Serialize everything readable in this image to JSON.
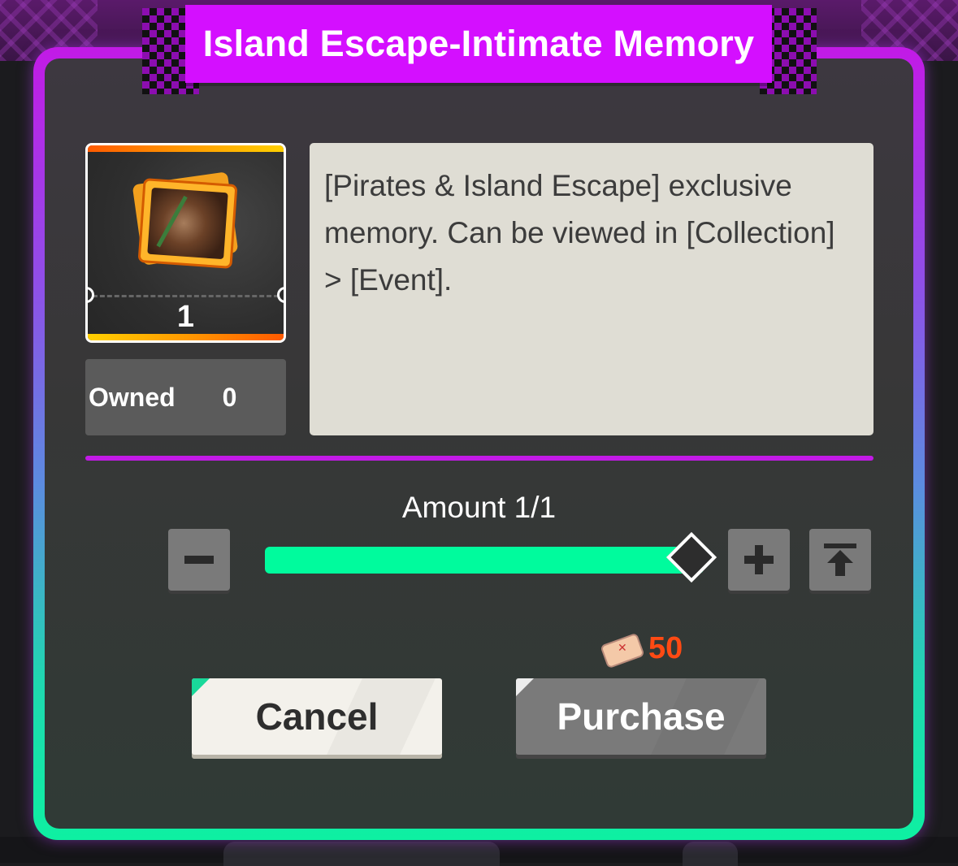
{
  "dialog": {
    "title": "Island Escape-Intimate Memory"
  },
  "item": {
    "icon": "memory-photo-icon",
    "quantity": "1",
    "owned_label": "Owned",
    "owned_value": "0",
    "description": "[Pirates & Island Escape] exclusive memory. Can be viewed in [Collection] > [Event]."
  },
  "amount": {
    "label": "Amount 1/1",
    "current": 1,
    "max": 1,
    "fill_fraction": 1.0
  },
  "price": {
    "currency_icon": "treasure-map-scroll-icon",
    "value": "50"
  },
  "buttons": {
    "cancel_label": "Cancel",
    "purchase_label": "Purchase",
    "minus_icon": "minus-icon",
    "plus_icon": "plus-icon",
    "max_icon": "max-arrow-icon"
  },
  "colors": {
    "title_ribbon": "#d40fff",
    "frame_top": "#c21ae6",
    "frame_bottom": "#0ef0a2",
    "slider_fill": "#00fb9d",
    "price_text": "#ff4a13"
  }
}
